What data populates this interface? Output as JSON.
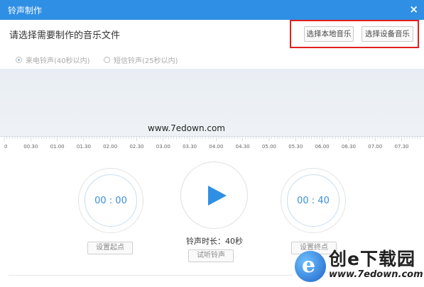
{
  "window": {
    "title": "铃声制作",
    "close_symbol": "×"
  },
  "heading": "请选择需要制作的音乐文件",
  "toolbar": {
    "local_music": "选择本地音乐",
    "device_music": "选择设备音乐"
  },
  "ring_types": [
    {
      "label": "来电铃声(40秒以内)",
      "selected": true
    },
    {
      "label": "短信铃声(25秒以内)",
      "selected": false
    }
  ],
  "timeline": {
    "ticks": [
      "0",
      "00.30",
      "01.00",
      "01.30",
      "02.00",
      "02.30",
      "03.00",
      "03.30",
      "04.00",
      "04.30",
      "05.00",
      "05.30",
      "06.00",
      "06.30",
      "07.00",
      "07.30"
    ]
  },
  "watermark": "www.7edown.com",
  "start_dial": {
    "value": "00 : 00",
    "button": "设置起点"
  },
  "end_dial": {
    "value": "00 : 40",
    "button": "设置终点"
  },
  "player": {
    "duration": "铃声时长：40秒",
    "preview_button": "试听铃声"
  },
  "logo": {
    "emblem": "e",
    "brand": "创e下载园",
    "url": "www.7edown.com"
  },
  "colors": {
    "titlebar": "#2f8fe4",
    "accent": "#3a8fd8",
    "highlight": "#e0201f"
  }
}
